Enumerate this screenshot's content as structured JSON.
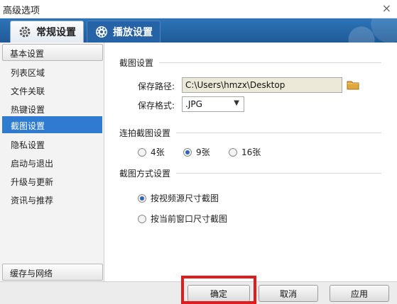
{
  "window": {
    "title": "高级选项",
    "close_glyph": "×"
  },
  "tabs": [
    {
      "label": "常规设置",
      "icon": "gear-icon",
      "active": true
    },
    {
      "label": "播放设置",
      "icon": "play-settings-icon",
      "active": false
    }
  ],
  "sidebar": {
    "header": "基本设置",
    "items": [
      {
        "label": "列表区域"
      },
      {
        "label": "文件关联"
      },
      {
        "label": "热键设置"
      },
      {
        "label": "截图设置",
        "selected": true
      },
      {
        "label": "隐私设置"
      },
      {
        "label": "启动与退出"
      },
      {
        "label": "升级与更新"
      },
      {
        "label": "资讯与推荐"
      }
    ],
    "footer": "缓存与网络"
  },
  "screenshot_settings": {
    "section_title": "截图设置",
    "save_path_label": "保存路径:",
    "save_path_value": "C:\\Users\\hmzx\\Desktop",
    "save_format_label": "保存格式:",
    "save_format_value": ".JPG"
  },
  "burst_settings": {
    "section_title": "连拍截图设置",
    "options": [
      {
        "label": "4张",
        "checked": false
      },
      {
        "label": "9张",
        "checked": true
      },
      {
        "label": "16张",
        "checked": false
      }
    ]
  },
  "capture_mode": {
    "section_title": "截图方式设置",
    "options": [
      {
        "label": "按视频源尺寸截图",
        "checked": true
      },
      {
        "label": "按当前窗口尺寸截图",
        "checked": false
      }
    ]
  },
  "buttons": {
    "ok": "确定",
    "cancel": "取消",
    "apply": "应用"
  },
  "colors": {
    "tab_bar": "#1f5a97",
    "selected_item": "#2e7bd1",
    "highlight_box": "#e01c1c"
  }
}
